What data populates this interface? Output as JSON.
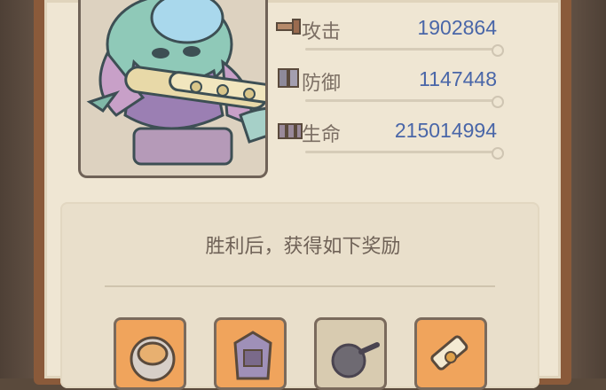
{
  "stats": [
    {
      "label": "攻击",
      "value": "1902864",
      "icon": "sword-icon"
    },
    {
      "label": "防御",
      "value": "1147448",
      "icon": "shield-icon"
    },
    {
      "label": "生命",
      "value": "215014994",
      "icon": "heart-icon"
    }
  ],
  "rewards": {
    "title": "胜利后，获得如下奖励",
    "items": [
      {
        "icon": "treasure-icon",
        "rarity_color": "#f0a45c"
      },
      {
        "icon": "armor-icon",
        "rarity_color": "#f0a45c"
      },
      {
        "icon": "bomb-icon",
        "rarity_color": "#d8cbb0"
      },
      {
        "icon": "tube-icon",
        "rarity_color": "#f0a45c"
      }
    ]
  },
  "colors": {
    "panel_bg": "#efe6d3",
    "value_text": "#4966a8",
    "label_text": "#7b6e63"
  }
}
